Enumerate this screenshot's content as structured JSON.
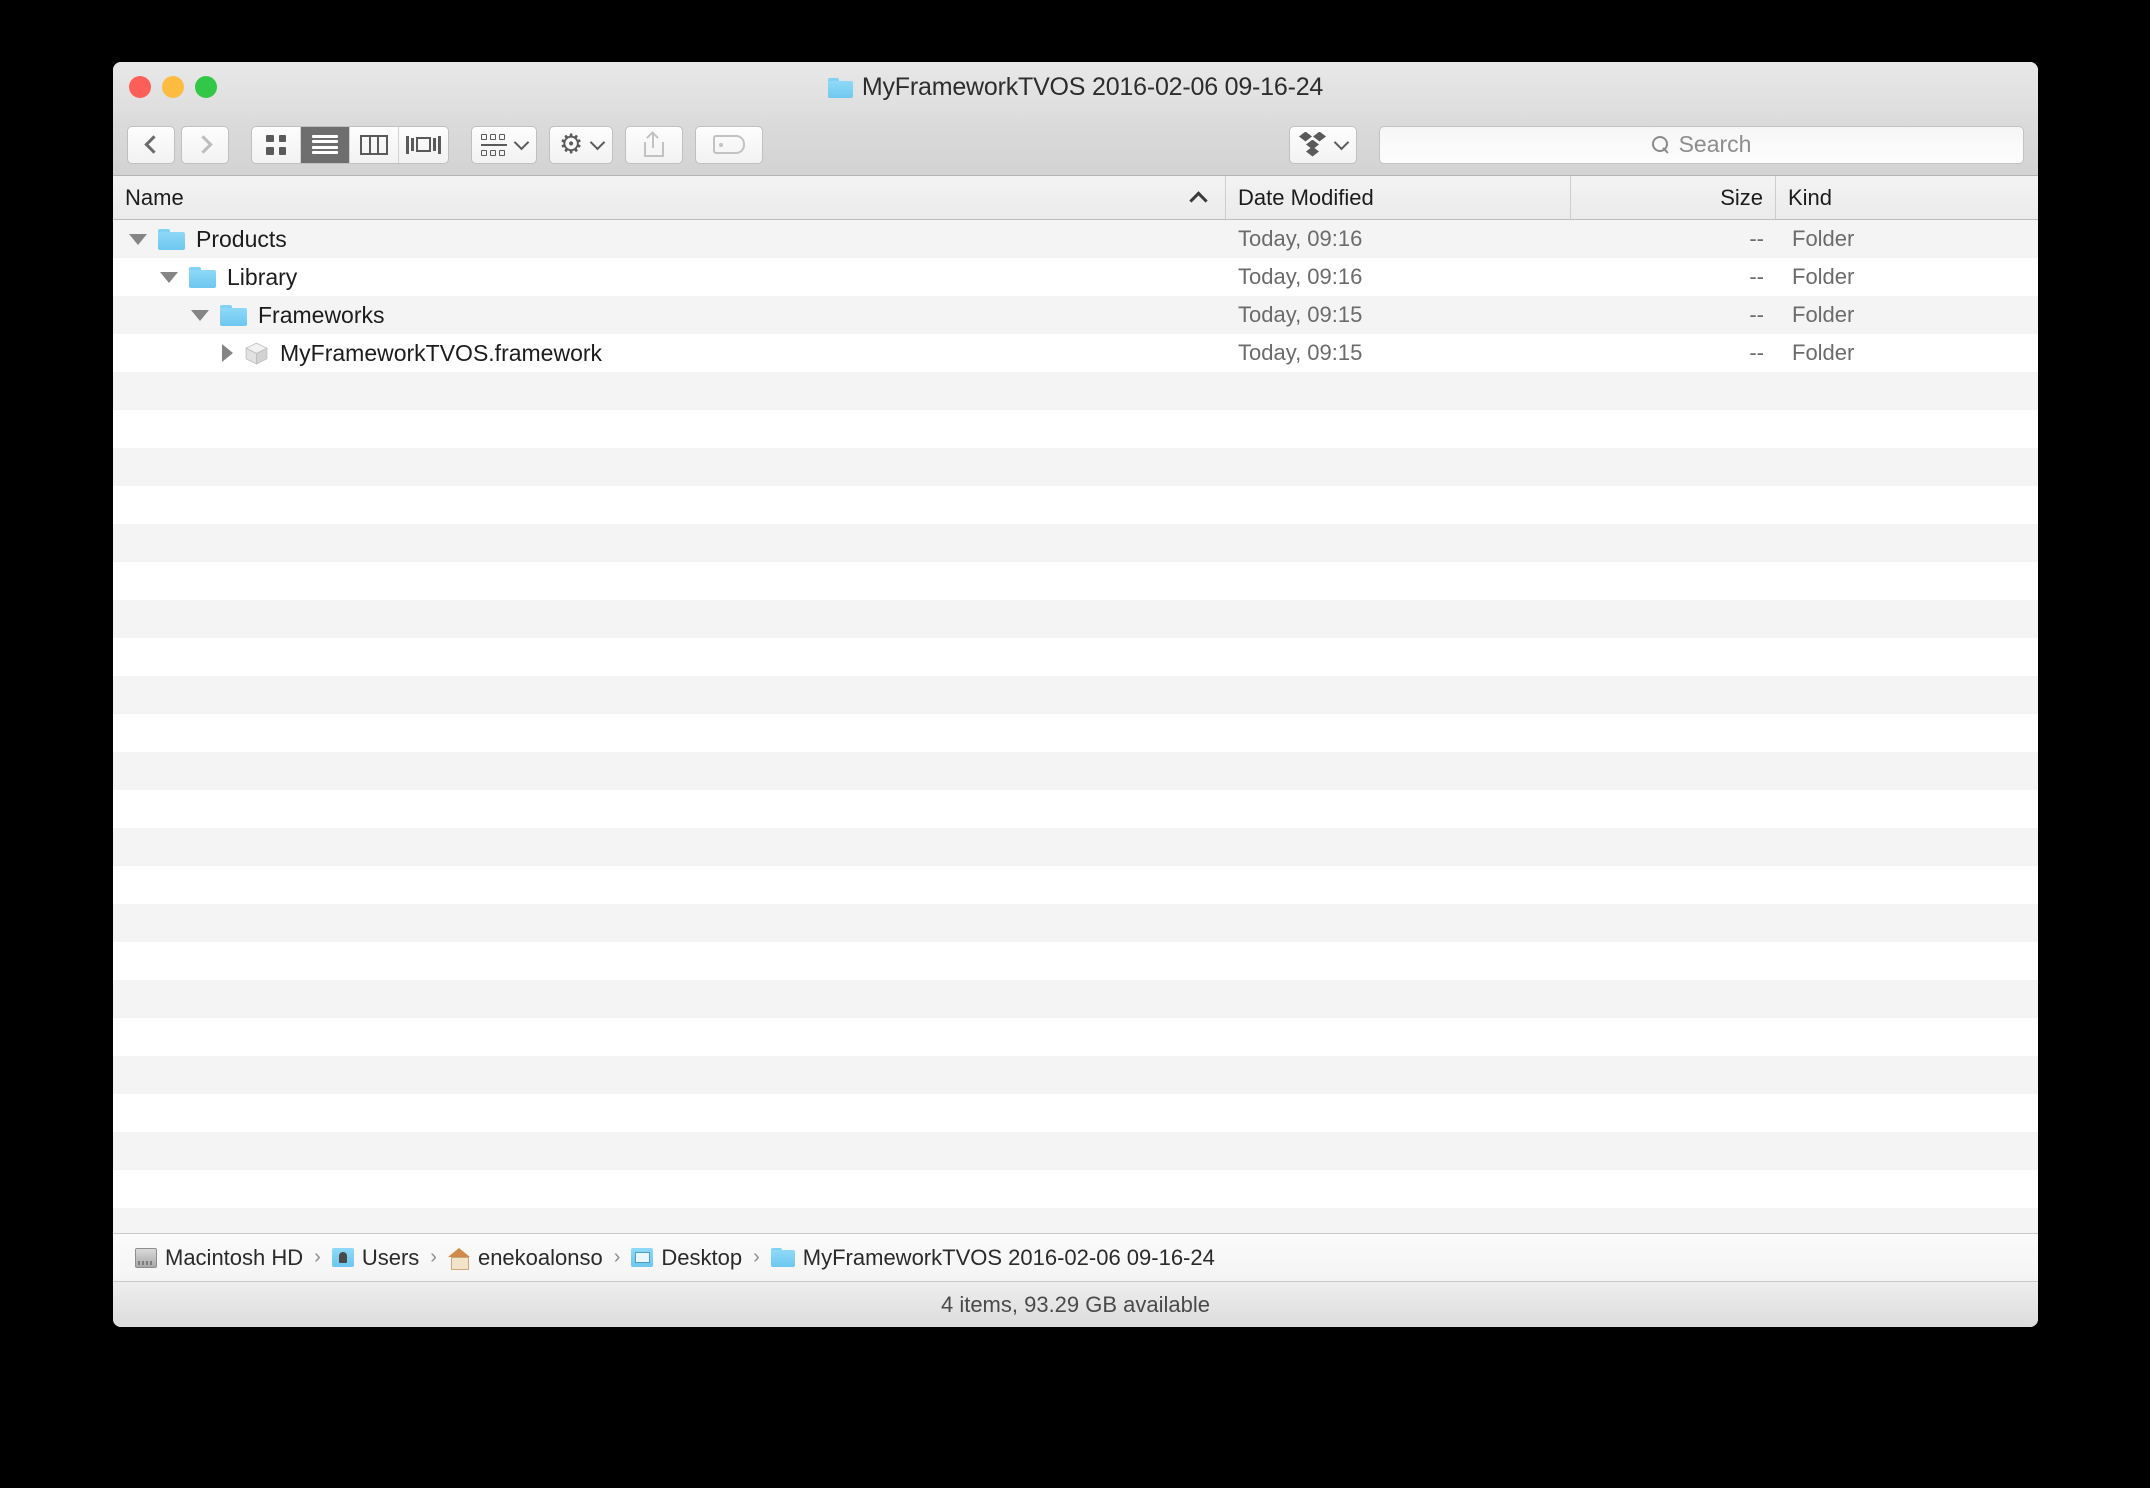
{
  "window": {
    "title": "MyFrameworkTVOS 2016-02-06 09-16-24",
    "title_icon": "folder-icon",
    "traffic_lights": {
      "close_color": "#fc5f57",
      "minimize_color": "#fdbc40",
      "maximize_color": "#33c748"
    }
  },
  "toolbar": {
    "back_icon": "chevron-left-icon",
    "forward_icon": "chevron-right-icon",
    "view_modes": [
      {
        "name": "icon-view",
        "icon": "grid-icon",
        "selected": false
      },
      {
        "name": "list-view",
        "icon": "list-lines-icon",
        "selected": true
      },
      {
        "name": "column-view",
        "icon": "columns-icon",
        "selected": false
      },
      {
        "name": "coverflow-view",
        "icon": "coverflow-icon",
        "selected": false
      }
    ],
    "arrange_icon": "arrange-icon",
    "action_icon": "gear-icon",
    "share_icon": "share-icon",
    "tag_icon": "tag-icon",
    "dropbox_icon": "dropbox-icon"
  },
  "search": {
    "icon": "search-icon",
    "placeholder": "Search",
    "value": ""
  },
  "columns": [
    {
      "key": "name",
      "label": "Name",
      "sorted": true,
      "sort_direction": "ascending"
    },
    {
      "key": "date",
      "label": "Date Modified"
    },
    {
      "key": "size",
      "label": "Size"
    },
    {
      "key": "kind",
      "label": "Kind"
    }
  ],
  "rows": [
    {
      "name": "Products",
      "date": "Today, 09:16",
      "size": "--",
      "kind": "Folder",
      "depth": 0,
      "icon": "folder-icon",
      "disclosure": "expanded"
    },
    {
      "name": "Library",
      "date": "Today, 09:16",
      "size": "--",
      "kind": "Folder",
      "depth": 1,
      "icon": "folder-icon",
      "disclosure": "expanded"
    },
    {
      "name": "Frameworks",
      "date": "Today, 09:15",
      "size": "--",
      "kind": "Folder",
      "depth": 2,
      "icon": "folder-icon",
      "disclosure": "expanded"
    },
    {
      "name": "MyFrameworkTVOS.framework",
      "date": "Today, 09:15",
      "size": "--",
      "kind": "Folder",
      "depth": 3,
      "icon": "framework-bundle-icon",
      "disclosure": "collapsed"
    }
  ],
  "breadcrumb": [
    {
      "label": "Macintosh HD",
      "icon": "hard-disk-icon"
    },
    {
      "label": "Users",
      "icon": "users-folder-icon"
    },
    {
      "label": "enekoalonso",
      "icon": "home-folder-icon"
    },
    {
      "label": "Desktop",
      "icon": "desktop-folder-icon"
    },
    {
      "label": "MyFrameworkTVOS 2016-02-06 09-16-24",
      "icon": "folder-icon"
    }
  ],
  "status": {
    "text": "4 items, 93.29 GB available"
  }
}
